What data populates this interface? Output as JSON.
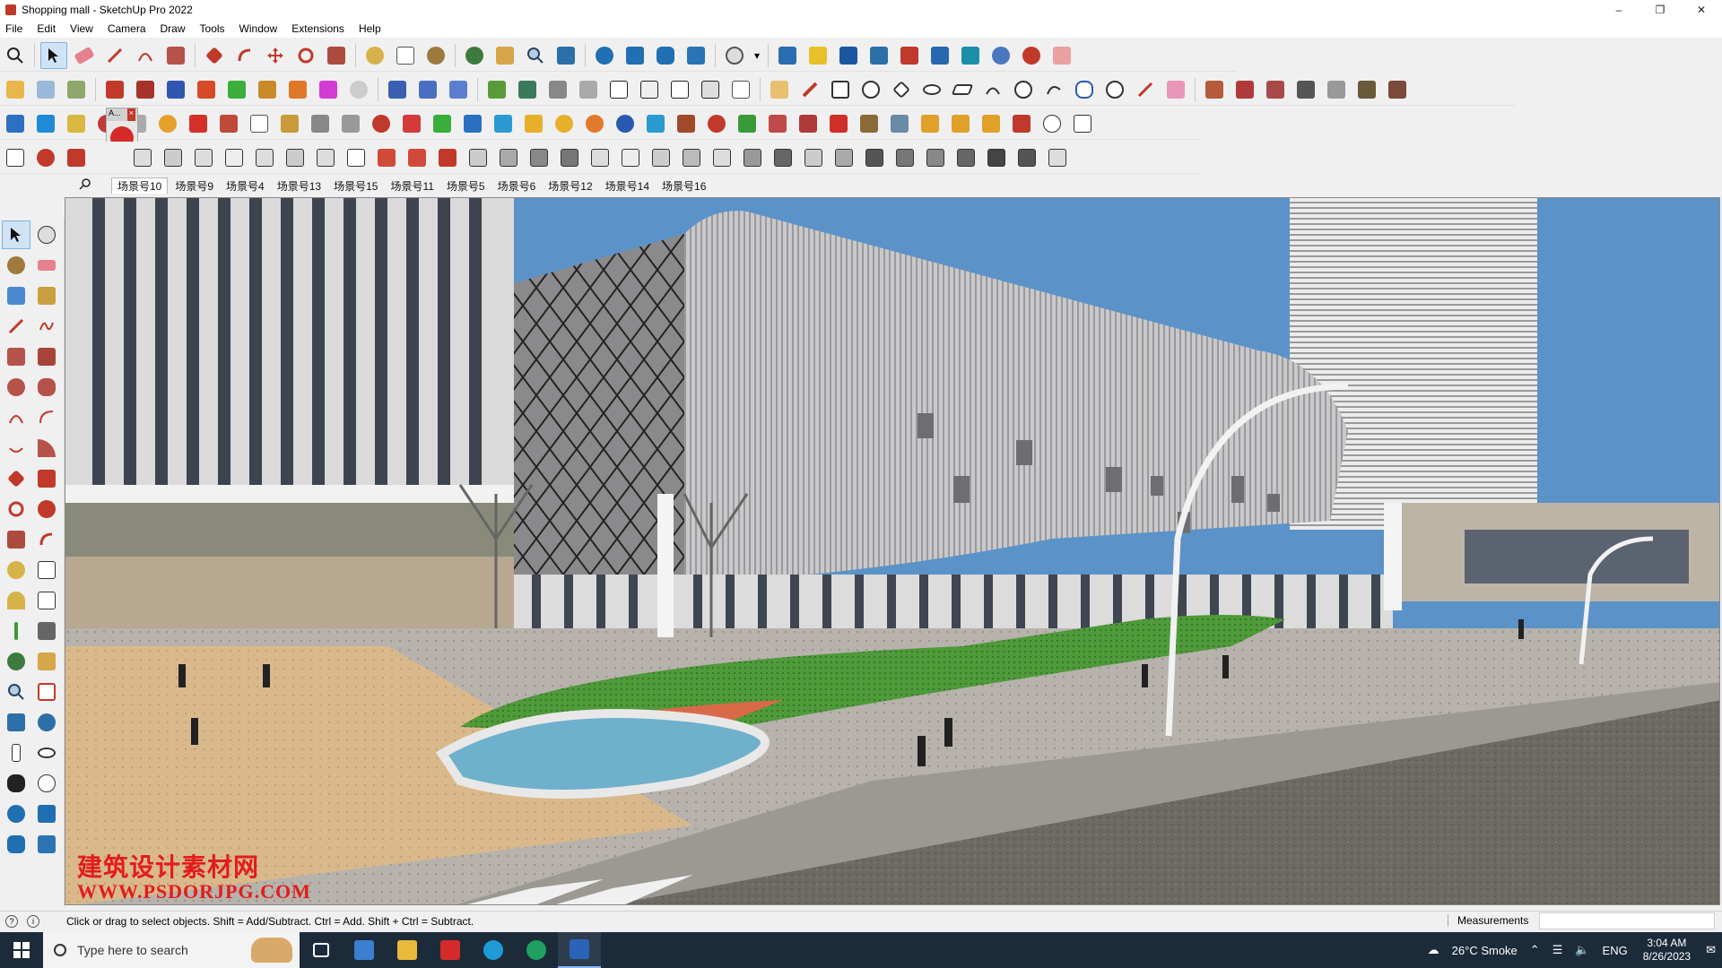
{
  "window": {
    "title": "Shopping mall - SketchUp Pro 2022",
    "controls": [
      "minimize",
      "maximize",
      "close"
    ]
  },
  "menubar": [
    "File",
    "Edit",
    "View",
    "Camera",
    "Draw",
    "Tools",
    "Window",
    "Extensions",
    "Help"
  ],
  "scene_tabs": {
    "active": "场景号10",
    "tabs": [
      "场景号10",
      "场景号9",
      "场景号4",
      "场景号13",
      "场景号15",
      "场景号11",
      "场景号5",
      "场景号6",
      "场景号12",
      "场景号14",
      "场景号16"
    ]
  },
  "watermark": {
    "chinese": "建筑设计素材网",
    "url": "WWW.PSDORJPG.COM"
  },
  "statusbar": {
    "hint": "Click or drag to select objects. Shift = Add/Subtract. Ctrl = Add. Shift + Ctrl = Subtract.",
    "measurements_label": "Measurements",
    "measurements_value": ""
  },
  "taskbar": {
    "search_placeholder": "Type here to search",
    "weather": "26°C  Smoke",
    "language": "ENG",
    "time": "3:04 AM",
    "date": "8/26/2023"
  },
  "colors": {
    "sky": "#5b93c8",
    "accent_red": "#e31c1c",
    "taskbar": "#1c2b3a"
  }
}
